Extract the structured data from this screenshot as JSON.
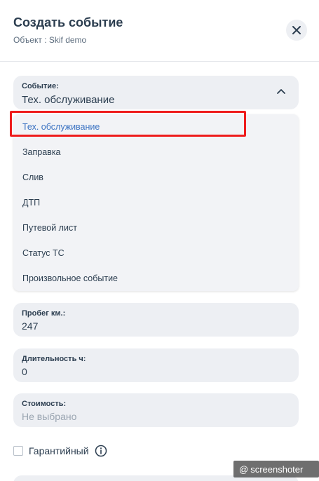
{
  "header": {
    "title": "Создать событие",
    "subtitle": "Объект : Skif demo"
  },
  "event_select": {
    "label": "Событие:",
    "value": "Тех. обслуживание",
    "options": [
      "Тех. обслуживание",
      "Заправка",
      "Слив",
      "ДТП",
      "Путевой лист",
      "Статус ТС",
      "Произвольное событие"
    ]
  },
  "mileage": {
    "label": "Пробег км.:",
    "value": "247"
  },
  "duration": {
    "label": "Длительность ч:",
    "value": "0"
  },
  "cost": {
    "label": "Стоимость:",
    "placeholder": "Не выбрано"
  },
  "warranty": {
    "label": "Гарантийный"
  },
  "watermark": {
    "text": "screenshoter"
  },
  "colors": {
    "selected_option": "#3a72c2",
    "highlight": "#ee1c1c",
    "field_bg": "#edeff3"
  },
  "icons": {
    "close": "close-icon",
    "chevron": "chevron-up-icon",
    "info": "info-icon"
  }
}
